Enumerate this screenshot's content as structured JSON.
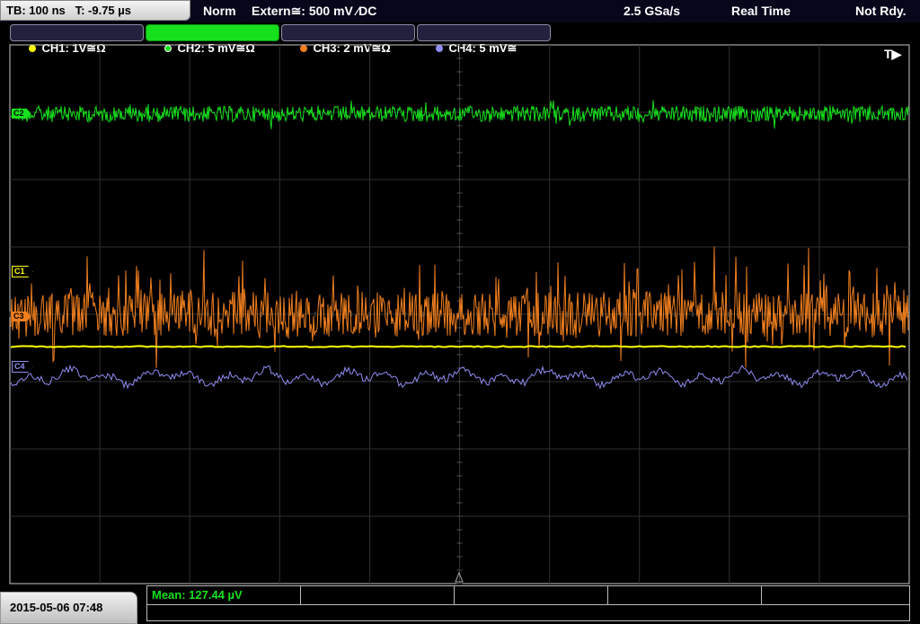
{
  "status": {
    "timebase": "TB: 100 ns   T: -9.75 µs",
    "mode": "Norm",
    "trigger": "Extern≅: 500 mV ⁄DC",
    "sample_rate": "2.5 GSa/s",
    "acq_mode": "Real Time",
    "ready": "Not Rdy."
  },
  "channels": [
    {
      "label": "CH1: 1V≅Ω",
      "color": "#ffff00",
      "marker": "C1"
    },
    {
      "label": "CH2: 5 mV≅Ω",
      "color": "#16e01c",
      "marker": "C2"
    },
    {
      "label": "CH3: 2 mV≅Ω",
      "color": "#f07f1e",
      "marker": "C3"
    },
    {
      "label": "CH4: 5 mV≅",
      "color": "#8f8cf2",
      "marker": "C4"
    }
  ],
  "trigger_position": "T▶",
  "bottom": {
    "datetime": "2015-05-06 07:48",
    "measurement": "Mean: 127.44 µV"
  }
}
